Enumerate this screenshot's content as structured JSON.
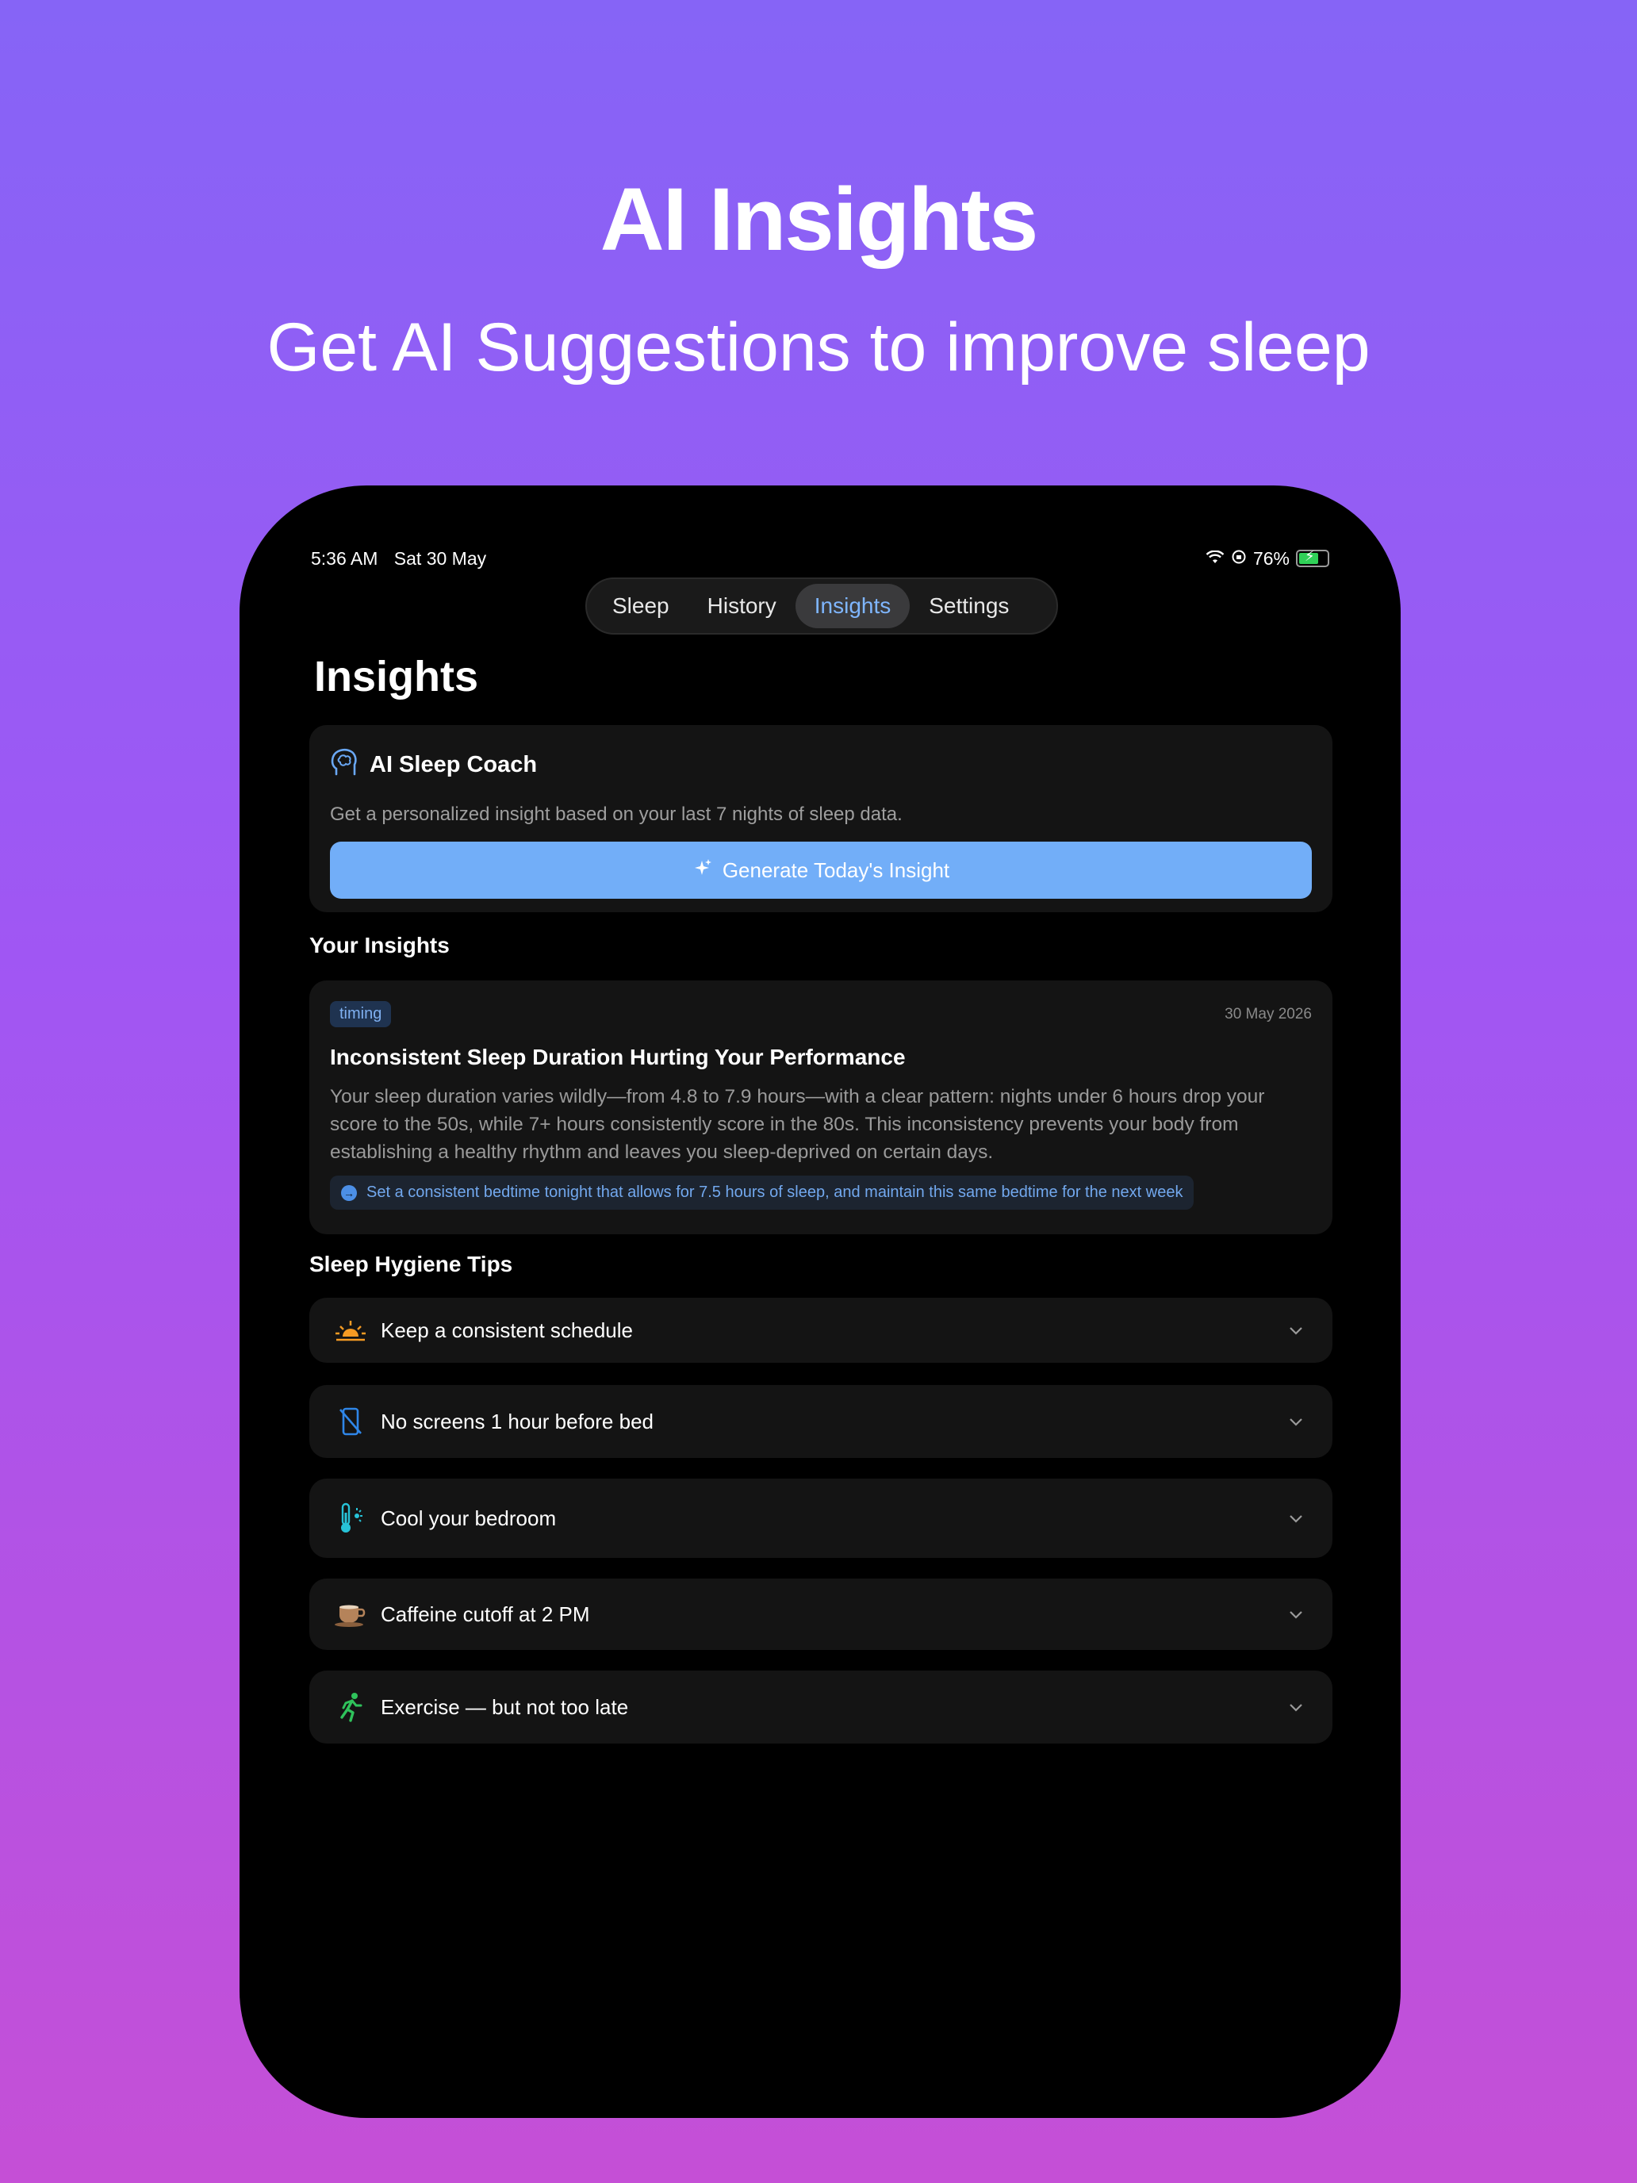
{
  "hero": {
    "title": "AI Insights",
    "subtitle": "Get AI Suggestions to improve sleep"
  },
  "status_bar": {
    "time": "5:36 AM",
    "date": "Sat 30 May",
    "battery": "76%"
  },
  "tabs": [
    {
      "label": "Sleep",
      "active": false
    },
    {
      "label": "History",
      "active": false
    },
    {
      "label": "Insights",
      "active": true
    },
    {
      "label": "Settings",
      "active": false
    }
  ],
  "page_title": "Insights",
  "coach": {
    "title": "AI Sleep Coach",
    "description": "Get a personalized insight based on your last 7 nights of sleep data.",
    "button_label": "Generate Today's Insight",
    "icon": "brain-head-icon"
  },
  "your_insights": {
    "section_title": "Your Insights",
    "items": [
      {
        "tag": "timing",
        "date": "30 May 2026",
        "title": "Inconsistent Sleep Duration Hurting Your Performance",
        "body": "Your sleep duration varies wildly—from 4.8 to 7.9 hours—with a clear pattern: nights under 6 hours drop your score to the 50s, while 7+ hours consistently score in the 80s. This inconsistency prevents your body from establishing a healthy rhythm and leaves you sleep-deprived on certain days.",
        "action": "Set a consistent bedtime tonight that allows for 7.5 hours of sleep, and maintain this same bedtime for the next week"
      }
    ]
  },
  "hygiene": {
    "section_title": "Sleep Hygiene Tips",
    "tips": [
      {
        "label": "Keep a consistent schedule",
        "icon": "sunrise-icon",
        "color": "#f59a23"
      },
      {
        "label": "No screens 1 hour before bed",
        "icon": "phone-slash-icon",
        "color": "#2f86e8"
      },
      {
        "label": "Cool your bedroom",
        "icon": "thermometer-icon",
        "color": "#27c3d8"
      },
      {
        "label": "Caffeine cutoff at 2 PM",
        "icon": "coffee-cup-icon",
        "color": "#b5835a"
      },
      {
        "label": "Exercise — but not too late",
        "icon": "running-person-icon",
        "color": "#2fc25b"
      }
    ]
  },
  "colors": {
    "accent": "#72aef8",
    "active_tab": "#7fb6ff",
    "card_bg": "#141414"
  }
}
